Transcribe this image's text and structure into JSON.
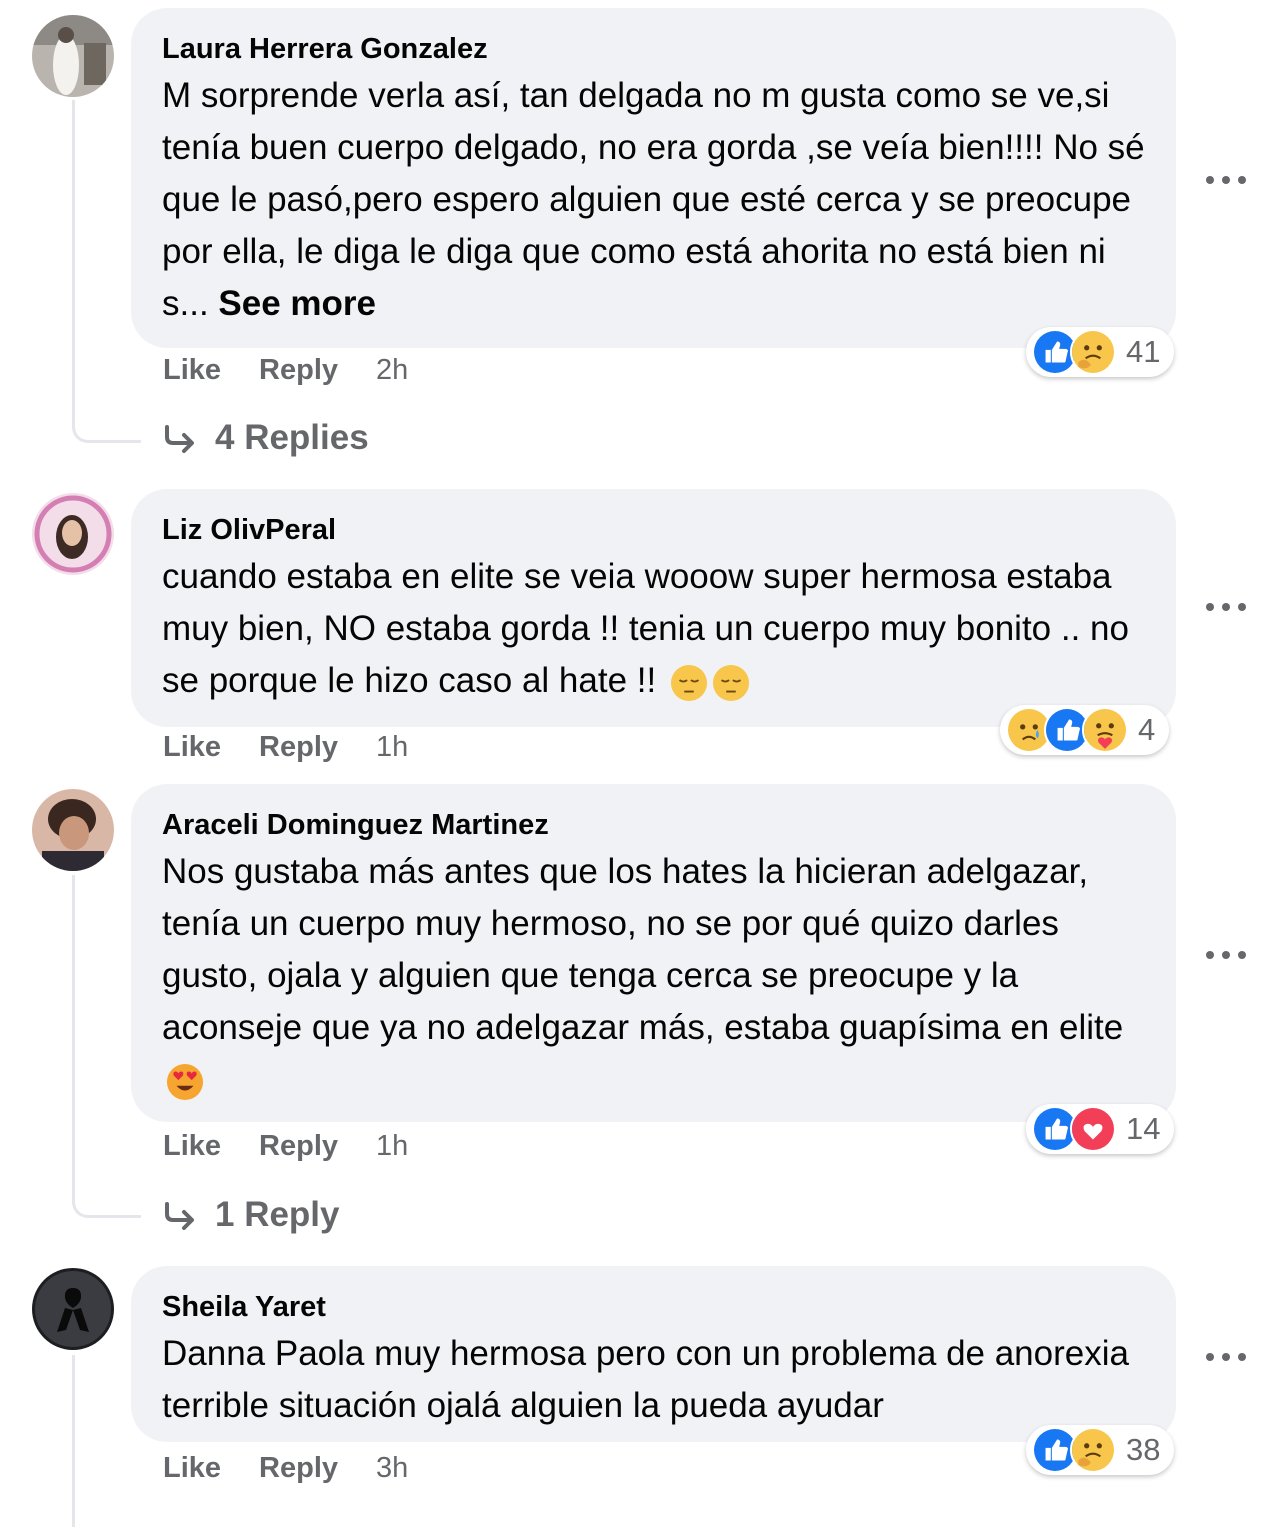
{
  "comments": [
    {
      "author": "Laura Herrera Gonzalez",
      "text": "M sorprende verla así, tan delgada no m gusta como se ve,si tenía buen cuerpo delgado, no era gorda ,se veía bien!!!! No sé que le pasó,pero espero alguien que esté cerca y se preocupe por ella, le diga le diga que como está ahorita no está bien ni s... ",
      "see_more": "See more",
      "like": "Like",
      "reply": "Reply",
      "time": "2h",
      "reaction_count": "41",
      "reactions": [
        "like-icon",
        "care-icon"
      ],
      "replies": "4 Replies"
    },
    {
      "author": "Liz OlivPeral",
      "text": "cuando estaba en elite se veia wooow super hermosa estaba muy bien, NO estaba gorda !! tenia un cuerpo muy bonito .. no se porque le hizo caso al hate !!",
      "like": "Like",
      "reply": "Reply",
      "time": "1h",
      "reaction_count": "4",
      "reactions": [
        "sad-icon",
        "like-icon",
        "care-icon"
      ],
      "trailing_emojis": [
        "pensive-emoji",
        "pensive-emoji"
      ]
    },
    {
      "author": "Araceli Dominguez Martinez",
      "text": "Nos gustaba más antes que los hates la hicieran adelgazar, tenía un cuerpo muy hermoso, no se por qué quizo darles gusto, ojala y alguien que tenga cerca se preocupe y la aconseje que ya no adelgazar más, estaba guapísima en elite",
      "like": "Like",
      "reply": "Reply",
      "time": "1h",
      "reaction_count": "14",
      "reactions": [
        "like-icon",
        "love-icon"
      ],
      "trailing_emojis": [
        "heart-eyes-emoji"
      ],
      "replies": "1 Reply"
    },
    {
      "author": "Sheila Yaret",
      "text": "Danna Paola muy hermosa pero con un problema de anorexia terrible situación ojalá alguien la pueda ayudar",
      "like": "Like",
      "reply": "Reply",
      "time": "3h",
      "reaction_count": "38",
      "reactions": [
        "like-icon",
        "care-icon"
      ]
    }
  ],
  "colors": {
    "bubble": "#f0f2f5",
    "secondary_text": "#65676b",
    "like_blue": "#1877f2",
    "love_red": "#f33e58",
    "emoji_yellow": "#f7c64a"
  }
}
